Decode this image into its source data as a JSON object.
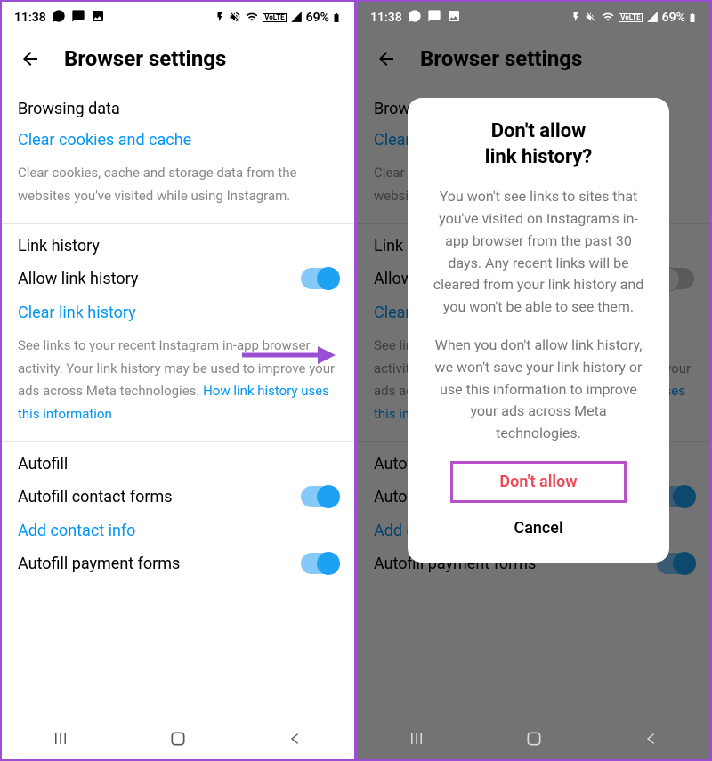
{
  "status": {
    "time": "11:38",
    "battery_text": "69%"
  },
  "header": {
    "title": "Browser settings"
  },
  "browsing_data": {
    "title": "Browsing data",
    "clear_link": "Clear cookies and cache",
    "desc": "Clear cookies, cache and storage data from the websites you've visited while using Instagram."
  },
  "link_history": {
    "title": "Link history",
    "allow_label": "Allow link history",
    "clear_link": "Clear link history",
    "desc": "See links to your recent Instagram in-app browser activity. Your link history may be used to improve your ads across Meta technologies. ",
    "info_link": "How link history uses this information"
  },
  "autofill": {
    "title": "Autofill",
    "contact_label": "Autofill contact forms",
    "add_contact_link": "Add contact info",
    "payment_label": "Autofill payment forms"
  },
  "dialog": {
    "title_line1": "Don't allow",
    "title_line2": "link history?",
    "para1": "You won't see links to sites that you've visited on Instagram's in-app browser from the past 30 days. Any recent links will be cleared from your link history and you won't be able to see them.",
    "para2": "When you don't allow link history, we won't save your link history or use this information to improve your ads across Meta technologies.",
    "primary": "Don't allow",
    "cancel": "Cancel"
  }
}
